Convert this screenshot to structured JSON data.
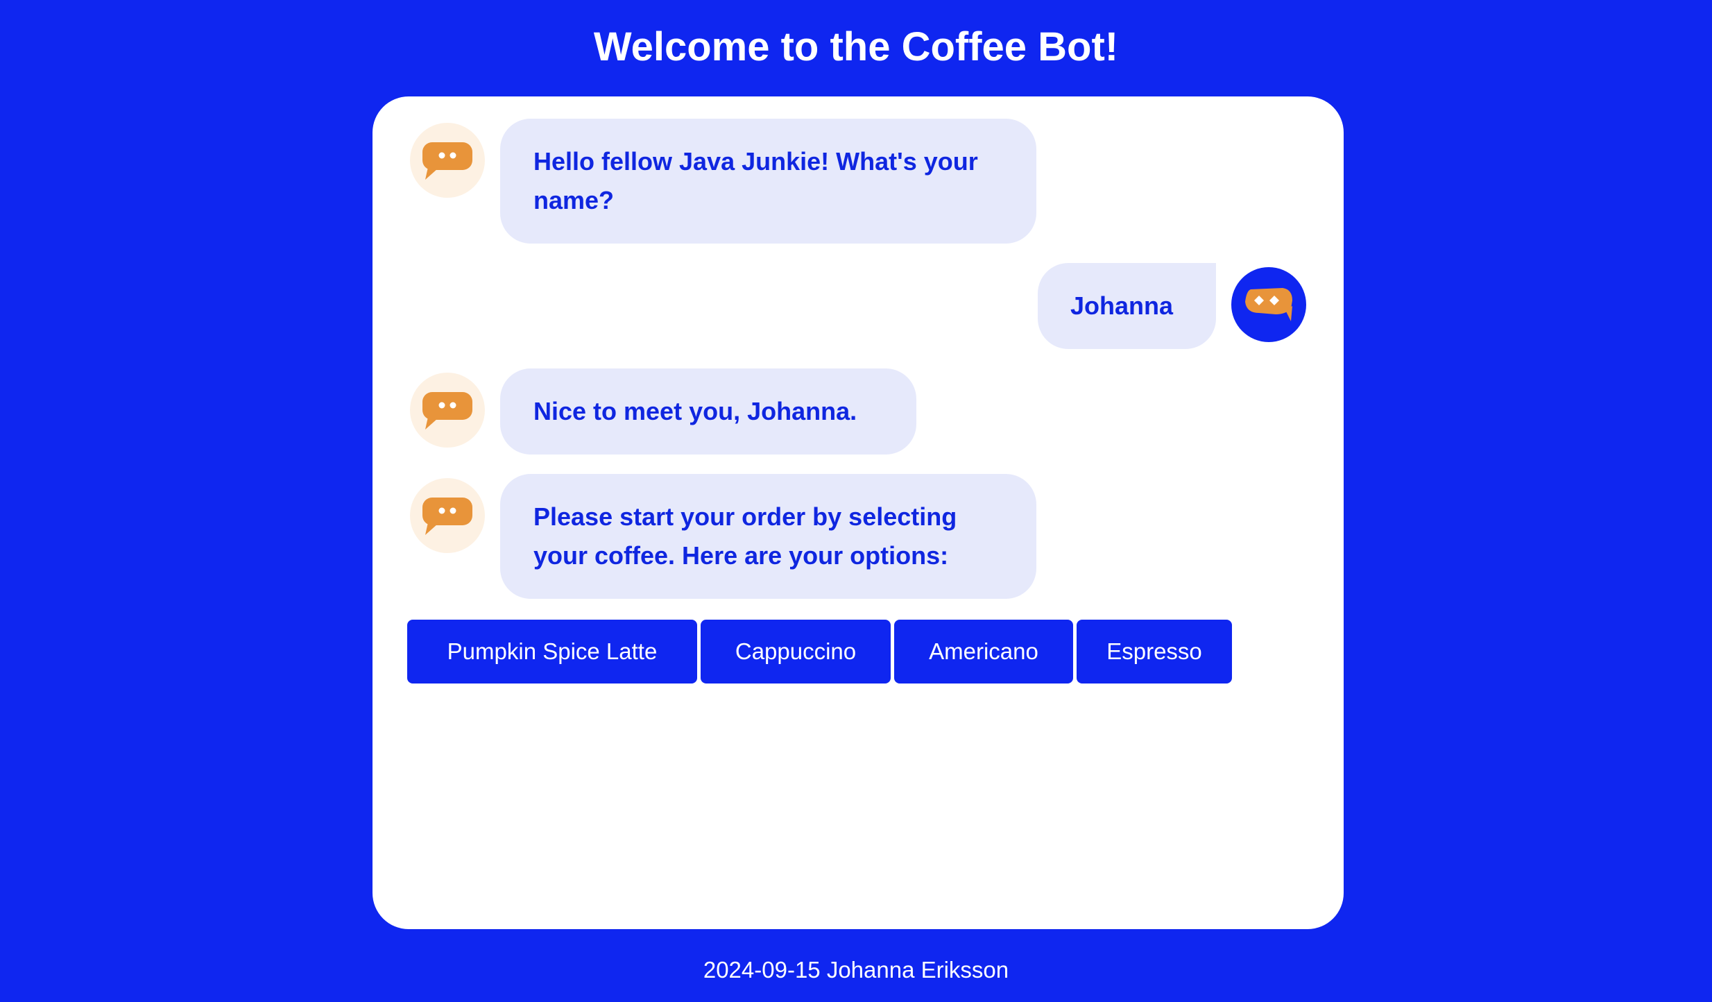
{
  "page": {
    "title": "Welcome to the Coffee Bot!",
    "footer": "2024-09-15 Johanna Eriksson"
  },
  "colors": {
    "background": "#0f26f0",
    "card": "#ffffff",
    "bubble": "#e6e9fb",
    "bubble_text": "#0f26e0",
    "avatar_icon": "#e8943a",
    "bot_avatar_bg": "#fdf1e3"
  },
  "chat": {
    "messages": [
      {
        "sender": "bot",
        "icon": "chat-bubble-icon",
        "text": "Hello fellow Java Junkie! What's your name?"
      },
      {
        "sender": "user",
        "icon": "chat-bubble-icon",
        "text": "Johanna"
      },
      {
        "sender": "bot",
        "icon": "chat-bubble-icon",
        "text": "Nice to meet you, Johanna."
      },
      {
        "sender": "bot",
        "icon": "chat-bubble-icon",
        "text": "Please start your order by selecting your coffee. Here are your options:"
      }
    ],
    "options": [
      "Pumpkin Spice Latte",
      "Cappuccino",
      "Americano",
      "Espresso"
    ]
  }
}
